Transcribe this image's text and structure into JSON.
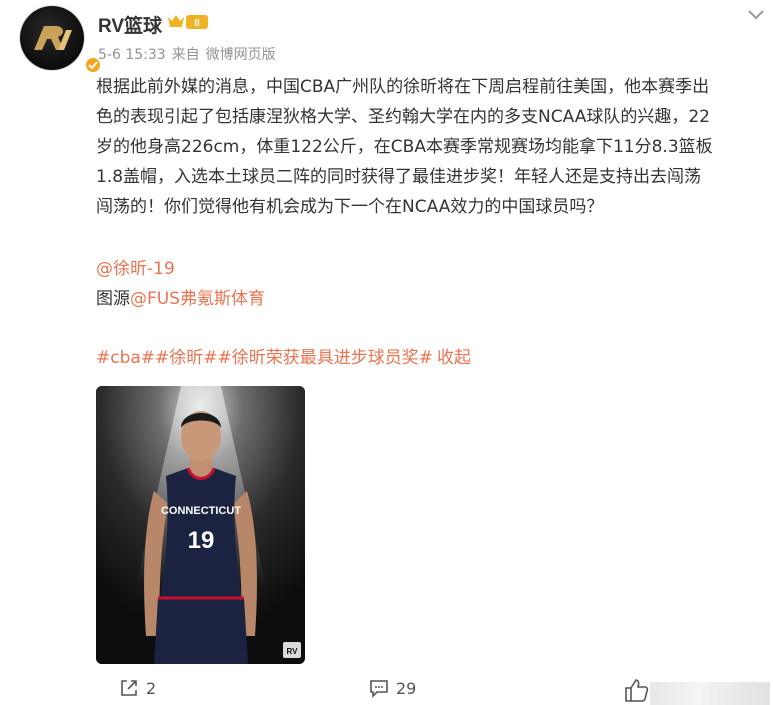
{
  "user": {
    "name": "RV篮球",
    "level": "II",
    "timestamp": "5-6 15:33",
    "source_prefix": "来自",
    "source": "微博网页版"
  },
  "post": {
    "lines": [
      "根据此前外媒的消息，中国CBA广州队的徐昕将在下周启程前往美国，他本赛季出",
      "色的表现引起了包括康涅狄格大学、圣约翰大学在内的多支NCAA球队的兴趣，22",
      "岁的他身高226cm，体重122公斤，在CBA本赛季常规赛场均能拿下11分8.3篮板",
      "1.8盖帽，入选本土球员二阵的同时获得了最佳进步奖！年轻人还是支持出去闯荡",
      "闯荡的！你们觉得他有机会成为下一个在NCAA效力的中国球员吗？"
    ],
    "mention": "@徐昕-19",
    "source_label": "图源",
    "source_link": "@FUS弗氪斯体育",
    "tags": [
      "#cba#",
      "#徐昕#",
      "#徐昕荣获最具进步球员奖#"
    ],
    "collapse": "收起"
  },
  "image": {
    "jersey_text": "CONNECTICUT",
    "jersey_number": "19",
    "corner_logo": "RV"
  },
  "footer": {
    "share_count": "2",
    "comment_count": "29",
    "like_count": ""
  },
  "colors": {
    "link": "#eb7350",
    "text": "#333333",
    "meta": "#939393",
    "badge": "#f7a51c"
  },
  "icons": {
    "menu": "chevron-down-icon",
    "share": "share-icon",
    "comment": "comment-icon",
    "like": "like-icon",
    "verified": "verified-icon"
  }
}
